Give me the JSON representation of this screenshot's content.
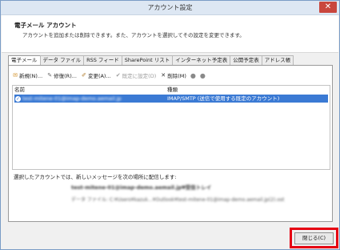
{
  "window": {
    "title": "アカウント設定",
    "close_glyph": "✕"
  },
  "header": {
    "title": "電子メール アカウント",
    "description": "アカウントを追加または削除できます。また、アカウントを選択してその設定を変更できます。"
  },
  "tabs": [
    {
      "label": "電子メール"
    },
    {
      "label": "データ ファイル"
    },
    {
      "label": "RSS フィード"
    },
    {
      "label": "SharePoint リスト"
    },
    {
      "label": "インターネット予定表"
    },
    {
      "label": "公開予定表"
    },
    {
      "label": "アドレス帳"
    }
  ],
  "toolbar": {
    "new_label": "新規(N)...",
    "repair_label": "修復(R)...",
    "change_label": "変更(A)...",
    "set_default_label": "既定に設定(D)",
    "remove_label": "削除(M)",
    "icons": {
      "new": "new-account-icon",
      "repair": "repair-icon",
      "change": "change-icon",
      "set_default": "set-default-icon",
      "remove": "remove-icon",
      "move_up": "move-up-icon",
      "move_down": "move-down-icon"
    }
  },
  "list": {
    "columns": {
      "name": "名前",
      "type": "種類"
    },
    "rows": [
      {
        "name": "test-mitene-01@imap-demo.aemail.jp",
        "type": "IMAP/SMTP (送信で使用する既定のアカウント)"
      }
    ]
  },
  "delivery": {
    "label": "選択したアカウントでは、新しいメッセージを次の場所に配信します:",
    "folder": "test-mitene-01@imap-demo.aemail.jp¥受信トレイ",
    "file": "データ ファイル: C:¥Users¥kazuk...¥Outlook¥test-mitene-01@imap-demo.aemail.jp(2).ost"
  },
  "footer": {
    "close_label": "閉じる(C)"
  },
  "colors": {
    "selection": "#3b7ad4",
    "highlight_border": "#e60012"
  }
}
